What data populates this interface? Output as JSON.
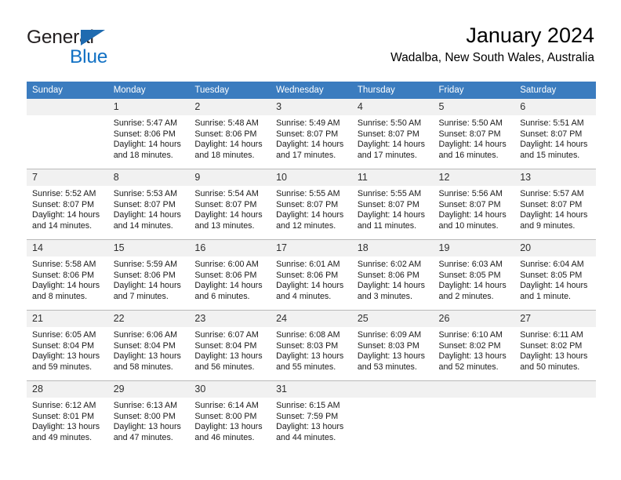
{
  "brand": {
    "name_part1": "General",
    "name_part2": "Blue",
    "accent_color": "#1271c4",
    "triangle_color": "#1f6bb0"
  },
  "header": {
    "title": "January 2024",
    "subtitle": "Wadalba, New South Wales, Australia"
  },
  "calendar": {
    "header_color": "#3b7cbf",
    "daynum_band_color": "#f1f1f1",
    "weekdays": [
      "Sunday",
      "Monday",
      "Tuesday",
      "Wednesday",
      "Thursday",
      "Friday",
      "Saturday"
    ],
    "weeks": [
      [
        {
          "day": "",
          "empty": true,
          "sunrise": "",
          "sunset": "",
          "daylight1": "",
          "daylight2": ""
        },
        {
          "day": "1",
          "empty": false,
          "sunrise": "Sunrise: 5:47 AM",
          "sunset": "Sunset: 8:06 PM",
          "daylight1": "Daylight: 14 hours",
          "daylight2": "and 18 minutes."
        },
        {
          "day": "2",
          "empty": false,
          "sunrise": "Sunrise: 5:48 AM",
          "sunset": "Sunset: 8:06 PM",
          "daylight1": "Daylight: 14 hours",
          "daylight2": "and 18 minutes."
        },
        {
          "day": "3",
          "empty": false,
          "sunrise": "Sunrise: 5:49 AM",
          "sunset": "Sunset: 8:07 PM",
          "daylight1": "Daylight: 14 hours",
          "daylight2": "and 17 minutes."
        },
        {
          "day": "4",
          "empty": false,
          "sunrise": "Sunrise: 5:50 AM",
          "sunset": "Sunset: 8:07 PM",
          "daylight1": "Daylight: 14 hours",
          "daylight2": "and 17 minutes."
        },
        {
          "day": "5",
          "empty": false,
          "sunrise": "Sunrise: 5:50 AM",
          "sunset": "Sunset: 8:07 PM",
          "daylight1": "Daylight: 14 hours",
          "daylight2": "and 16 minutes."
        },
        {
          "day": "6",
          "empty": false,
          "sunrise": "Sunrise: 5:51 AM",
          "sunset": "Sunset: 8:07 PM",
          "daylight1": "Daylight: 14 hours",
          "daylight2": "and 15 minutes."
        }
      ],
      [
        {
          "day": "7",
          "empty": false,
          "sunrise": "Sunrise: 5:52 AM",
          "sunset": "Sunset: 8:07 PM",
          "daylight1": "Daylight: 14 hours",
          "daylight2": "and 14 minutes."
        },
        {
          "day": "8",
          "empty": false,
          "sunrise": "Sunrise: 5:53 AM",
          "sunset": "Sunset: 8:07 PM",
          "daylight1": "Daylight: 14 hours",
          "daylight2": "and 14 minutes."
        },
        {
          "day": "9",
          "empty": false,
          "sunrise": "Sunrise: 5:54 AM",
          "sunset": "Sunset: 8:07 PM",
          "daylight1": "Daylight: 14 hours",
          "daylight2": "and 13 minutes."
        },
        {
          "day": "10",
          "empty": false,
          "sunrise": "Sunrise: 5:55 AM",
          "sunset": "Sunset: 8:07 PM",
          "daylight1": "Daylight: 14 hours",
          "daylight2": "and 12 minutes."
        },
        {
          "day": "11",
          "empty": false,
          "sunrise": "Sunrise: 5:55 AM",
          "sunset": "Sunset: 8:07 PM",
          "daylight1": "Daylight: 14 hours",
          "daylight2": "and 11 minutes."
        },
        {
          "day": "12",
          "empty": false,
          "sunrise": "Sunrise: 5:56 AM",
          "sunset": "Sunset: 8:07 PM",
          "daylight1": "Daylight: 14 hours",
          "daylight2": "and 10 minutes."
        },
        {
          "day": "13",
          "empty": false,
          "sunrise": "Sunrise: 5:57 AM",
          "sunset": "Sunset: 8:07 PM",
          "daylight1": "Daylight: 14 hours",
          "daylight2": "and 9 minutes."
        }
      ],
      [
        {
          "day": "14",
          "empty": false,
          "sunrise": "Sunrise: 5:58 AM",
          "sunset": "Sunset: 8:06 PM",
          "daylight1": "Daylight: 14 hours",
          "daylight2": "and 8 minutes."
        },
        {
          "day": "15",
          "empty": false,
          "sunrise": "Sunrise: 5:59 AM",
          "sunset": "Sunset: 8:06 PM",
          "daylight1": "Daylight: 14 hours",
          "daylight2": "and 7 minutes."
        },
        {
          "day": "16",
          "empty": false,
          "sunrise": "Sunrise: 6:00 AM",
          "sunset": "Sunset: 8:06 PM",
          "daylight1": "Daylight: 14 hours",
          "daylight2": "and 6 minutes."
        },
        {
          "day": "17",
          "empty": false,
          "sunrise": "Sunrise: 6:01 AM",
          "sunset": "Sunset: 8:06 PM",
          "daylight1": "Daylight: 14 hours",
          "daylight2": "and 4 minutes."
        },
        {
          "day": "18",
          "empty": false,
          "sunrise": "Sunrise: 6:02 AM",
          "sunset": "Sunset: 8:06 PM",
          "daylight1": "Daylight: 14 hours",
          "daylight2": "and 3 minutes."
        },
        {
          "day": "19",
          "empty": false,
          "sunrise": "Sunrise: 6:03 AM",
          "sunset": "Sunset: 8:05 PM",
          "daylight1": "Daylight: 14 hours",
          "daylight2": "and 2 minutes."
        },
        {
          "day": "20",
          "empty": false,
          "sunrise": "Sunrise: 6:04 AM",
          "sunset": "Sunset: 8:05 PM",
          "daylight1": "Daylight: 14 hours",
          "daylight2": "and 1 minute."
        }
      ],
      [
        {
          "day": "21",
          "empty": false,
          "sunrise": "Sunrise: 6:05 AM",
          "sunset": "Sunset: 8:04 PM",
          "daylight1": "Daylight: 13 hours",
          "daylight2": "and 59 minutes."
        },
        {
          "day": "22",
          "empty": false,
          "sunrise": "Sunrise: 6:06 AM",
          "sunset": "Sunset: 8:04 PM",
          "daylight1": "Daylight: 13 hours",
          "daylight2": "and 58 minutes."
        },
        {
          "day": "23",
          "empty": false,
          "sunrise": "Sunrise: 6:07 AM",
          "sunset": "Sunset: 8:04 PM",
          "daylight1": "Daylight: 13 hours",
          "daylight2": "and 56 minutes."
        },
        {
          "day": "24",
          "empty": false,
          "sunrise": "Sunrise: 6:08 AM",
          "sunset": "Sunset: 8:03 PM",
          "daylight1": "Daylight: 13 hours",
          "daylight2": "and 55 minutes."
        },
        {
          "day": "25",
          "empty": false,
          "sunrise": "Sunrise: 6:09 AM",
          "sunset": "Sunset: 8:03 PM",
          "daylight1": "Daylight: 13 hours",
          "daylight2": "and 53 minutes."
        },
        {
          "day": "26",
          "empty": false,
          "sunrise": "Sunrise: 6:10 AM",
          "sunset": "Sunset: 8:02 PM",
          "daylight1": "Daylight: 13 hours",
          "daylight2": "and 52 minutes."
        },
        {
          "day": "27",
          "empty": false,
          "sunrise": "Sunrise: 6:11 AM",
          "sunset": "Sunset: 8:02 PM",
          "daylight1": "Daylight: 13 hours",
          "daylight2": "and 50 minutes."
        }
      ],
      [
        {
          "day": "28",
          "empty": false,
          "sunrise": "Sunrise: 6:12 AM",
          "sunset": "Sunset: 8:01 PM",
          "daylight1": "Daylight: 13 hours",
          "daylight2": "and 49 minutes."
        },
        {
          "day": "29",
          "empty": false,
          "sunrise": "Sunrise: 6:13 AM",
          "sunset": "Sunset: 8:00 PM",
          "daylight1": "Daylight: 13 hours",
          "daylight2": "and 47 minutes."
        },
        {
          "day": "30",
          "empty": false,
          "sunrise": "Sunrise: 6:14 AM",
          "sunset": "Sunset: 8:00 PM",
          "daylight1": "Daylight: 13 hours",
          "daylight2": "and 46 minutes."
        },
        {
          "day": "31",
          "empty": false,
          "sunrise": "Sunrise: 6:15 AM",
          "sunset": "Sunset: 7:59 PM",
          "daylight1": "Daylight: 13 hours",
          "daylight2": "and 44 minutes."
        },
        {
          "day": "",
          "empty": true,
          "sunrise": "",
          "sunset": "",
          "daylight1": "",
          "daylight2": ""
        },
        {
          "day": "",
          "empty": true,
          "sunrise": "",
          "sunset": "",
          "daylight1": "",
          "daylight2": ""
        },
        {
          "day": "",
          "empty": true,
          "sunrise": "",
          "sunset": "",
          "daylight1": "",
          "daylight2": ""
        }
      ]
    ]
  }
}
